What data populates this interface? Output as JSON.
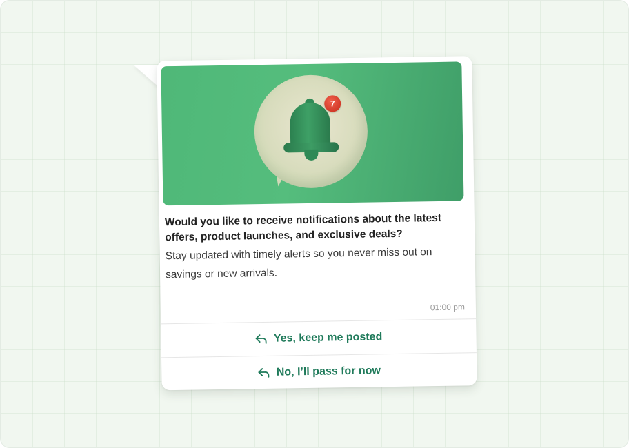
{
  "message": {
    "badge_count": "7",
    "title": "Would you like to receive notifications about the latest offers, product launches, and exclusive deals?",
    "body": "Stay updated with timely alerts so you never miss out on savings or new arrivals.",
    "time": "01:00 pm"
  },
  "quick_replies": [
    {
      "label": "Yes, keep me posted",
      "icon": "reply-icon"
    },
    {
      "label": "No, I’ll pass for now",
      "icon": "reply-icon"
    }
  ],
  "colors": {
    "accent": "#1f7a5a",
    "hero_green": "#4fb878",
    "badge_red": "#d93a28",
    "background": "#f1f7f0"
  }
}
